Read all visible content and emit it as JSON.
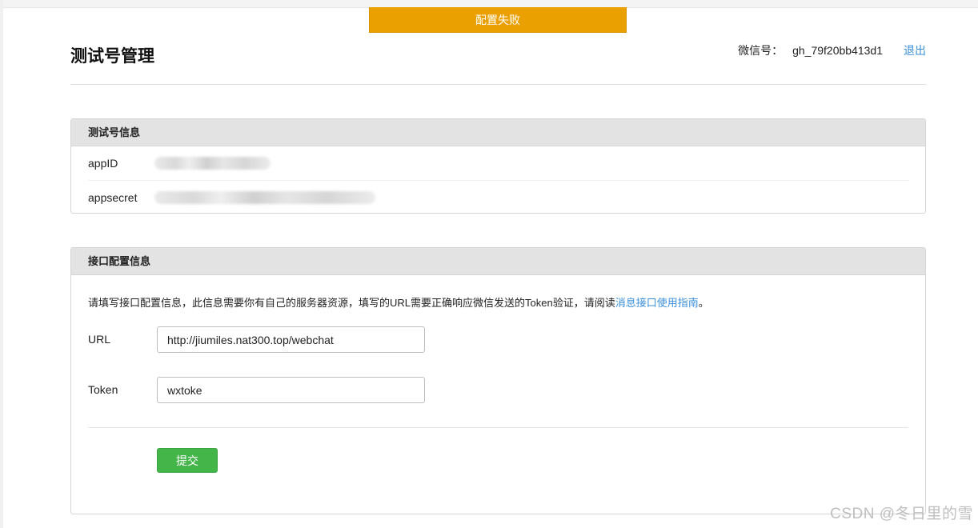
{
  "toast": {
    "message": "配置失败"
  },
  "header": {
    "title": "测试号管理",
    "account_label": "微信号：",
    "account_value": "gh_79f20bb413d1",
    "logout_label": "退出"
  },
  "test_info": {
    "heading": "测试号信息",
    "appid_label": "appID",
    "appsecret_label": "appsecret"
  },
  "interface_config": {
    "heading": "接口配置信息",
    "description": "请填写接口配置信息，此信息需要你有自己的服务器资源，填写的URL需要正确响应微信发送的Token验证，请阅读",
    "guide_link": "消息接口使用指南",
    "description_end": "。",
    "url_label": "URL",
    "url_value": "http://jiumiles.nat300.top/webchat",
    "token_label": "Token",
    "token_value": "wxtoke",
    "submit_label": "提交"
  },
  "watermark": "CSDN @冬日里的雪",
  "colors": {
    "toast_bg": "#e9a000",
    "link": "#3a8fd9",
    "submit_bg": "#44b549",
    "panel_head_bg": "#e3e3e3"
  }
}
